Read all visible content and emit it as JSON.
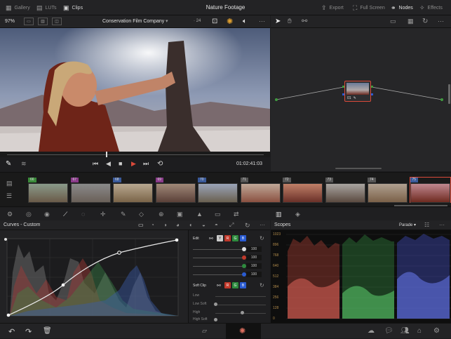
{
  "topbar": {
    "gallery": "Gallery",
    "luts": "LUTs",
    "clips": "Clips",
    "title": "Nature Footage",
    "export": "Export",
    "full_screen": "Full Screen",
    "nodes": "Nodes",
    "effects": "Effects"
  },
  "viewer": {
    "zoom": "97%",
    "clip_name": "Conservation Film Company",
    "fps": "24",
    "timecode": "01:02:41:03"
  },
  "node": {
    "label": "01"
  },
  "timeline": {
    "clips": [
      "66",
      "67",
      "68",
      "69",
      "70",
      "71",
      "72",
      "73",
      "74",
      "75"
    ],
    "clip_colors": [
      "#3a8a3a",
      "#8a3a8a",
      "#3a5a9a",
      "#8a3a8a",
      "#3a5a9a",
      "#555555",
      "#555555",
      "#555555",
      "#555555",
      "#3a5a9a"
    ]
  },
  "curves": {
    "title": "Curves - Custom",
    "edit_label": "Edit",
    "channels": [
      "Y",
      "R",
      "G",
      "B"
    ],
    "values": [
      "100",
      "100",
      "100",
      "100"
    ],
    "soft_clip_label": "Soft Clip",
    "soft_rows": [
      "Low",
      "Low Soft",
      "High",
      "High Soft"
    ]
  },
  "scopes": {
    "title": "Scopes",
    "mode": "Parade",
    "scale": [
      "1023",
      "896",
      "768",
      "640",
      "512",
      "384",
      "256",
      "128",
      "0"
    ]
  },
  "colors": {
    "accent": "#d94a3a",
    "red": "#c0392b",
    "green": "#2e8b3e",
    "blue": "#2a5bd1"
  }
}
